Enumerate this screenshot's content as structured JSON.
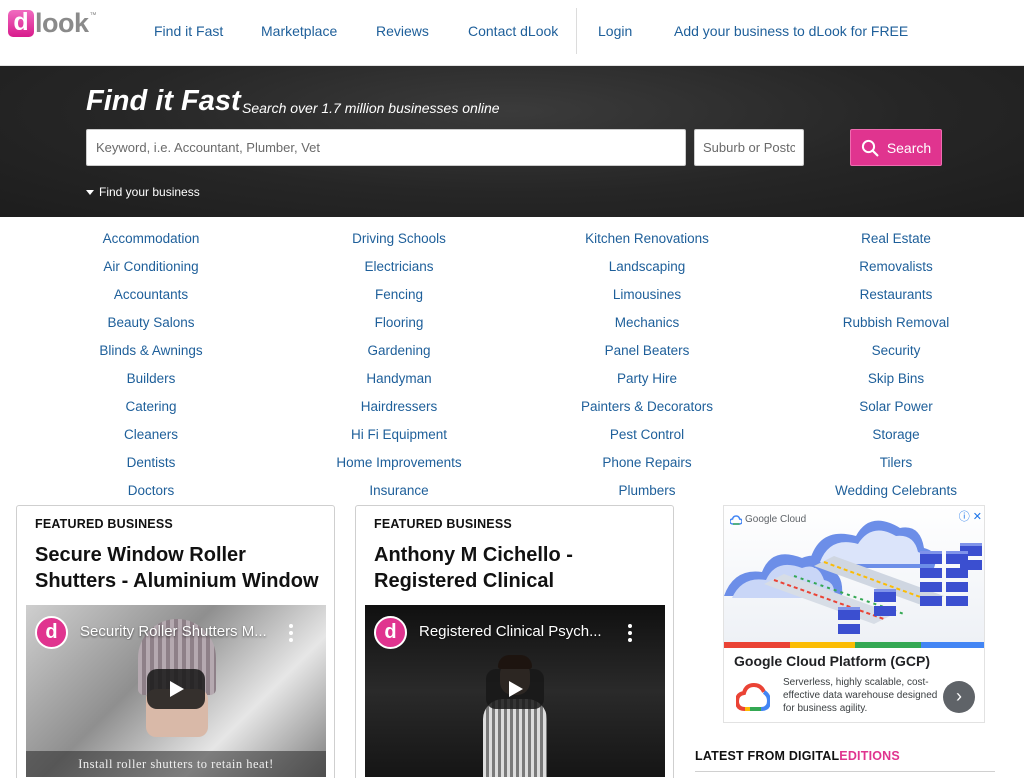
{
  "header": {
    "logo": {
      "mark": "d",
      "rest": "look",
      "tm": "™"
    },
    "nav": [
      {
        "label": "Find it Fast"
      },
      {
        "label": "Marketplace"
      },
      {
        "label": "Reviews"
      },
      {
        "label": "Contact dLook"
      },
      {
        "label": "Login"
      },
      {
        "label": "Add your business to dLook for FREE"
      }
    ]
  },
  "hero": {
    "title": "Find it Fast",
    "subtitle": "Search over 1.7 million businesses online",
    "keyword_placeholder": "Keyword, i.e. Accountant, Plumber, Vet",
    "location_placeholder": "Suburb or Postcode",
    "search_label": "Search",
    "find_business_label": "Find your business"
  },
  "categories": [
    [
      "Accommodation",
      "Air Conditioning",
      "Accountants",
      "Beauty Salons",
      "Blinds & Awnings",
      "Builders",
      "Catering",
      "Cleaners",
      "Dentists",
      "Doctors"
    ],
    [
      "Driving Schools",
      "Electricians",
      "Fencing",
      "Flooring",
      "Gardening",
      "Handyman",
      "Hairdressers",
      "Hi Fi Equipment",
      "Home Improvements",
      "Insurance"
    ],
    [
      "Kitchen Renovations",
      "Landscaping",
      "Limousines",
      "Mechanics",
      "Panel Beaters",
      "Party Hire",
      "Painters & Decorators",
      "Pest Control",
      "Phone Repairs",
      "Plumbers"
    ],
    [
      "Real Estate",
      "Removalists",
      "Restaurants",
      "Rubbish Removal",
      "Security",
      "Skip Bins",
      "Solar Power",
      "Storage",
      "Tilers",
      "Wedding Celebrants"
    ]
  ],
  "featured": [
    {
      "label": "FEATURED BUSINESS",
      "title": "Secure Window Roller Shutters - Aluminium Window",
      "video_title": "Security Roller Shutters M...",
      "video_caption": "Install roller shutters to retain heat!"
    },
    {
      "label": "FEATURED BUSINESS",
      "title": "Anthony M Cichello - Registered Clinical",
      "video_title": "Registered Clinical Psych...",
      "video_caption": ""
    }
  ],
  "ad": {
    "brand": "Google Cloud",
    "title": "Google Cloud Platform (GCP)",
    "description": "Serverless, highly scalable, cost-effective data warehouse designed for business agility.",
    "colors": [
      "#ea4335",
      "#fbbc04",
      "#34a853",
      "#4285f4"
    ]
  },
  "latest": {
    "prefix": "LATEST FROM DIGITAL",
    "highlight": "EDITIONS"
  },
  "colors": {
    "accent": "#e0348f",
    "link": "#1e5f9a",
    "hero_bg": "#262626"
  }
}
